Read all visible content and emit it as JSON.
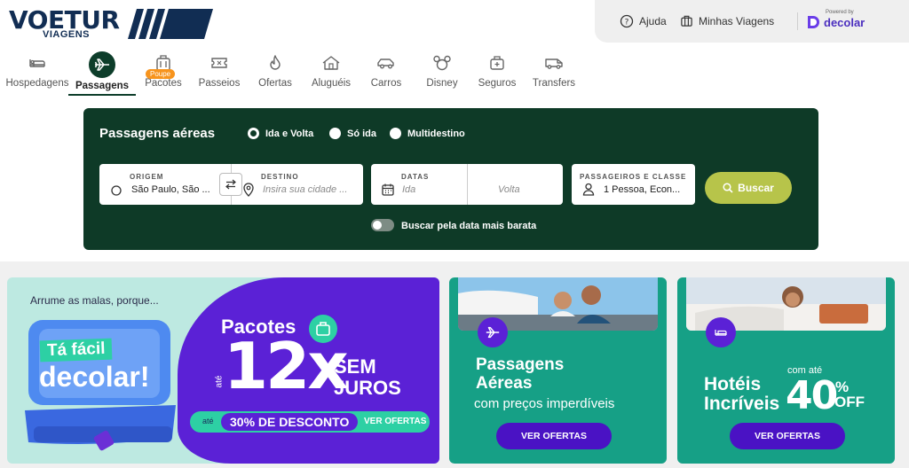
{
  "brand": {
    "name": "VOETUR",
    "sub": "VIAGENS"
  },
  "utility": {
    "help": "Ajuda",
    "trips": "Minhas Viagens",
    "powered_by": "Powered by",
    "partner": "decolar"
  },
  "nav": {
    "items": [
      {
        "label": "Hospedagens",
        "icon": "bed-icon"
      },
      {
        "label": "Passagens",
        "icon": "airplane-icon",
        "active": true
      },
      {
        "label": "Pacotes",
        "icon": "luggage-icon",
        "badge": "Poupe"
      },
      {
        "label": "Passeios",
        "icon": "ticket-icon"
      },
      {
        "label": "Ofertas",
        "icon": "flame-icon"
      },
      {
        "label": "Aluguéis",
        "icon": "house-icon"
      },
      {
        "label": "Carros",
        "icon": "car-icon"
      },
      {
        "label": "Disney",
        "icon": "mickey-icon"
      },
      {
        "label": "Seguros",
        "icon": "medical-bag-icon"
      },
      {
        "label": "Transfers",
        "icon": "van-icon"
      }
    ]
  },
  "search": {
    "title": "Passagens aéreas",
    "trip_types": [
      "Ida e Volta",
      "Só ida",
      "Multidestino"
    ],
    "selected_trip_type": "Ida e Volta",
    "origin": {
      "label": "ORIGEM",
      "value": "São Paulo, São ..."
    },
    "destination": {
      "label": "DESTINO",
      "placeholder": "Insira sua cidade ..."
    },
    "dates": {
      "label": "DATAS",
      "depart_placeholder": "Ida",
      "return_placeholder": "Volta"
    },
    "passengers": {
      "label": "PASSAGEIROS E CLASSE",
      "value": "1 Pessoa, Econ..."
    },
    "button": "Buscar",
    "cheapest_toggle": "Buscar pela data mais barata",
    "accent": "#b7c44a",
    "panel_color": "#0e3a27"
  },
  "promos": {
    "packages": {
      "tagline": "Arrume as malas, porque...",
      "headline_1": "Tá fácil",
      "headline_2": "decolar!",
      "title": "Pacotes",
      "ate": "até",
      "installments": "12x",
      "no_interest": "SEM JUROS",
      "discount_prefix": "até",
      "discount": "30% DE DESCONTO",
      "cta": "VER OFERTAS"
    },
    "flights": {
      "title": "Passagens Aéreas",
      "subtitle": "com preços imperdíveis",
      "cta": "VER OFERTAS"
    },
    "hotels": {
      "title": "Hotéis Incríveis",
      "prefix": "com até",
      "percent": "40",
      "percent_sign": "%",
      "off": "OFF",
      "cta": "VER OFERTAS"
    }
  }
}
